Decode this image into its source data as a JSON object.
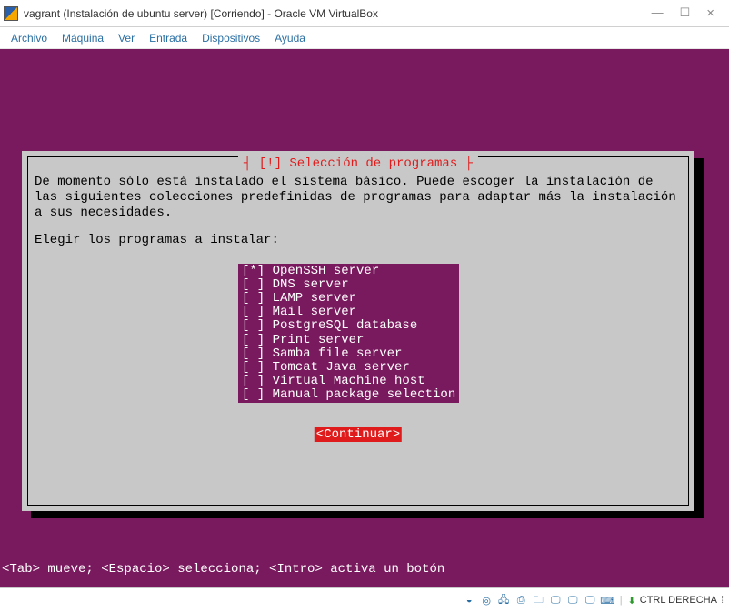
{
  "window": {
    "title": "vagrant (Instalación de ubuntu server) [Corriendo] - Oracle VM VirtualBox"
  },
  "menu": {
    "items": [
      "Archivo",
      "Máquina",
      "Ver",
      "Entrada",
      "Dispositivos",
      "Ayuda"
    ]
  },
  "dialog": {
    "title_decor_left": "┤ ",
    "title_decor_right": " ├",
    "title": "[!] Selección de programas",
    "paragraph": "De momento sólo está instalado el sistema básico. Puede escoger la instalación de las siguientes colecciones predefinidas de programas para adaptar más la instalación a sus necesidades.",
    "prompt": "Elegir los programas a instalar:",
    "items": [
      {
        "checked": true,
        "label": "OpenSSH server"
      },
      {
        "checked": false,
        "label": "DNS server"
      },
      {
        "checked": false,
        "label": "LAMP server"
      },
      {
        "checked": false,
        "label": "Mail server"
      },
      {
        "checked": false,
        "label": "PostgreSQL database"
      },
      {
        "checked": false,
        "label": "Print server"
      },
      {
        "checked": false,
        "label": "Samba file server"
      },
      {
        "checked": false,
        "label": "Tomcat Java server"
      },
      {
        "checked": false,
        "label": "Virtual Machine host"
      },
      {
        "checked": false,
        "label": "Manual package selection"
      }
    ],
    "continue": "<Continuar>"
  },
  "hint": "<Tab> mueve; <Espacio> selecciona; <Intro> activa un botón",
  "status": {
    "host_key": "CTRL DERECHA"
  }
}
